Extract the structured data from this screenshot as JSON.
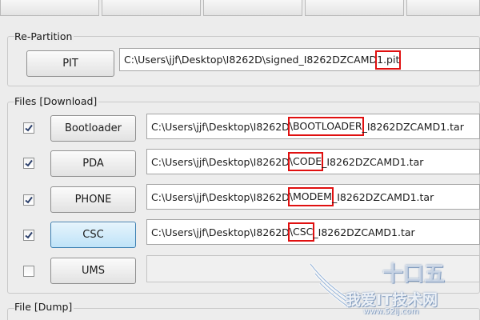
{
  "repartition": {
    "title": "Re-Partition",
    "pit_button": "PIT",
    "pit_path_prefix": "C:\\Users\\jjf\\Desktop\\I8262D\\signed_I8262DZCAMD",
    "pit_path_highlight": "1.pit"
  },
  "files": {
    "title": "Files [Download]",
    "rows": [
      {
        "label": "Bootloader",
        "checked": true,
        "active": false,
        "prefix": "C:\\Users\\jjf\\Desktop\\I8262D",
        "highlight": "\\BOOTLOADER",
        "suffix": "_I8262DZCAMD1.tar"
      },
      {
        "label": "PDA",
        "checked": true,
        "active": false,
        "prefix": "C:\\Users\\jjf\\Desktop\\I8262D",
        "highlight": "\\CODE",
        "suffix": "_I8262DZCAMD1.tar"
      },
      {
        "label": "PHONE",
        "checked": true,
        "active": false,
        "prefix": "C:\\Users\\jjf\\Desktop\\I8262D",
        "highlight": "\\MODEM",
        "suffix": "_I8262DZCAMD1.tar"
      },
      {
        "label": "CSC",
        "checked": true,
        "active": true,
        "prefix": "C:\\Users\\jjf\\Desktop\\I8262D",
        "highlight": "\\CSC",
        "suffix": "_I8262DZCAMD1.tar"
      },
      {
        "label": "UMS",
        "checked": false,
        "active": false,
        "prefix": "",
        "highlight": "",
        "suffix": ""
      }
    ]
  },
  "dump": {
    "title": "File [Dump]"
  },
  "watermark": {
    "cn_text": "我爱IT技术网",
    "url_text": "www.52ij.com",
    "logo_text": "十口五"
  },
  "colors": {
    "highlight_box": "#e01010",
    "active_button": "#bfe3f8",
    "watermark_blue": "#7fa2cc"
  }
}
